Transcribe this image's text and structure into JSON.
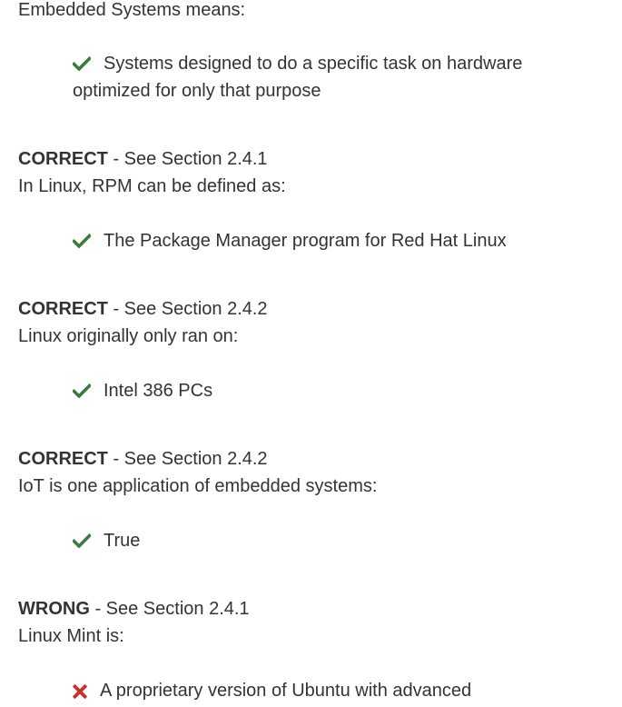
{
  "quiz": {
    "q1": {
      "question": "Embedded Systems means:",
      "answer": "Systems designed to do a specific task on hardware optimized for only that purpose",
      "result": "CORRECT",
      "reference": " - See Section 2.4.1"
    },
    "q2": {
      "question": "In Linux, RPM can be defined as:",
      "answer": "The Package Manager program for Red Hat Linux",
      "result": "CORRECT",
      "reference": " - See Section 2.4.2"
    },
    "q3": {
      "question": "Linux originally only ran on:",
      "answer": "Intel 386 PCs",
      "result": "CORRECT",
      "reference": " - See Section 2.4.2"
    },
    "q4": {
      "question": "IoT is one application of embedded systems:",
      "answer": "True",
      "result": "WRONG",
      "reference": " - See Section 2.4.1"
    },
    "q5": {
      "question": "Linux Mint is:",
      "answer": "A proprietary version of Ubuntu with advanced"
    }
  },
  "colors": {
    "check": "#3c7a3f",
    "cross": "#c9302c",
    "text": "#333333"
  },
  "icons": {
    "correct": "checkmark-icon",
    "wrong": "cross-icon"
  }
}
